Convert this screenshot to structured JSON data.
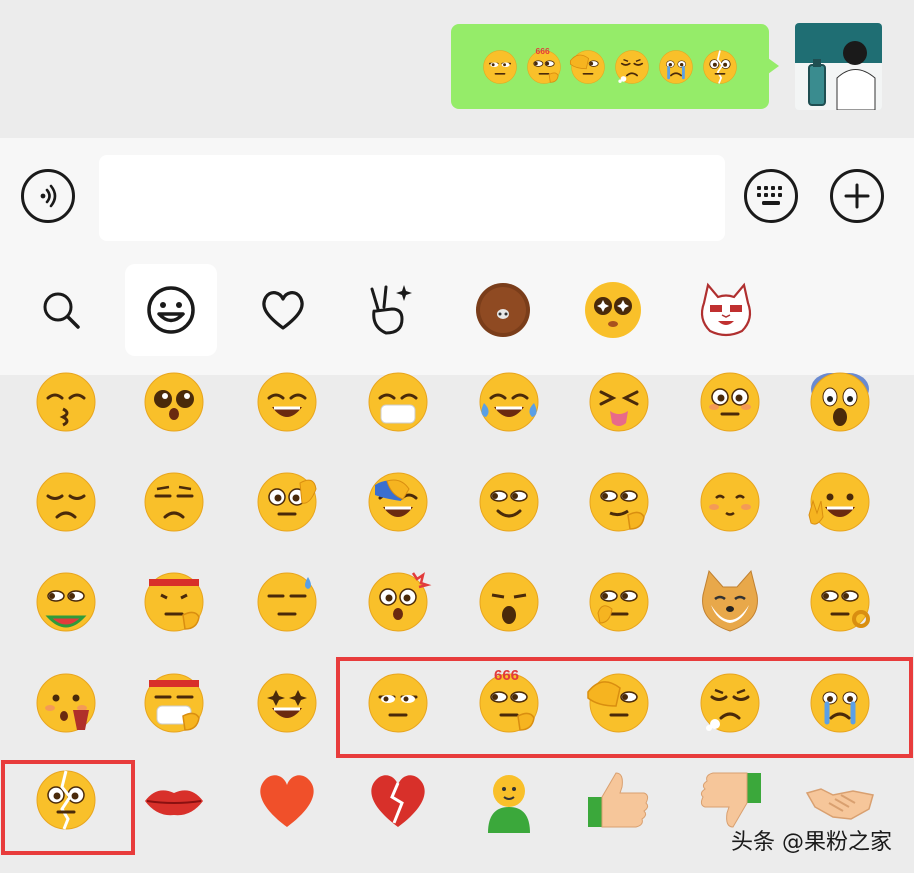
{
  "chat": {
    "sent_emojis": [
      "smirk",
      "666-smirk",
      "facepalm",
      "sigh",
      "sob",
      "cracked"
    ]
  },
  "input": {
    "value": "",
    "placeholder": ""
  },
  "tabs": [
    "search",
    "emoji",
    "favorites",
    "gesture",
    "brown-circle",
    "star-eyes",
    "cat-sticker"
  ],
  "emoji_grid": [
    [
      "kiss",
      "pleading",
      "grin",
      "mask-smile",
      "tears-of-joy",
      "squint-tongue",
      "flushed",
      "scream"
    ],
    [
      "pensive",
      "unamused",
      "peek-hand",
      "facepalm-laugh",
      "side-eye",
      "smirk-point",
      "shy",
      "peace-grin"
    ],
    [
      "eat-watermelon",
      "headband-fist",
      "sweat",
      "shock-anger",
      "blow",
      "think-smirk",
      "doge",
      "ok-smirk"
    ],
    [
      "hand-mouth",
      "mask-headband",
      "star-struck",
      "smirk",
      "666-smirk",
      "facepalm",
      "sigh",
      "sob"
    ],
    [
      "cracked",
      "lips",
      "heart",
      "broken-heart",
      "green-person",
      "thumbs-up",
      "thumbs-down",
      "handshake"
    ]
  ],
  "colors": {
    "bubble": "#95ec69",
    "highlight": "#e83c3c",
    "face": "#f9c02a"
  },
  "watermark": "头条 @果粉之家"
}
